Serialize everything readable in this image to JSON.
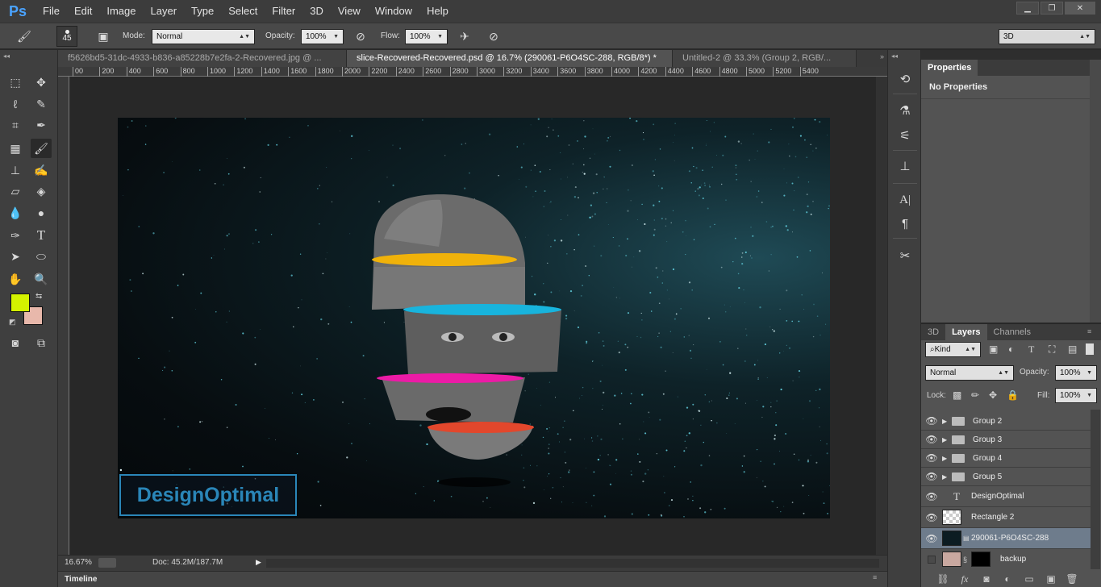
{
  "app": {
    "logo": "Ps"
  },
  "menu": [
    "File",
    "Edit",
    "Image",
    "Layer",
    "Type",
    "Select",
    "Filter",
    "3D",
    "View",
    "Window",
    "Help"
  ],
  "window_controls": {
    "minimize": "▁",
    "restore": "❐",
    "close": "✕"
  },
  "options": {
    "brush_size": "45",
    "mode_label": "Mode:",
    "mode_value": "Normal",
    "opacity_label": "Opacity:",
    "opacity_value": "100%",
    "flow_label": "Flow:",
    "flow_value": "100%",
    "workspace_value": "3D"
  },
  "tabs": [
    {
      "label": "f5626bd5-31dc-4933-b836-a85228b7e2fa-2-Recovered.jpg @ ..."
    },
    {
      "label": "slice-Recovered-Recovered.psd @ 16.7% (290061-P6O4SC-288, RGB/8*) *"
    },
    {
      "label": "Untitled-2 @ 33.3% (Group 2, RGB/..."
    }
  ],
  "ruler": [
    "00",
    "200",
    "400",
    "600",
    "800",
    "1000",
    "1200",
    "1400",
    "1600",
    "1800",
    "2000",
    "2200",
    "2400",
    "2600",
    "2800",
    "3000",
    "3200",
    "3400",
    "3600",
    "3800",
    "4000",
    "4200",
    "4400",
    "4600",
    "4800",
    "5000",
    "5200",
    "5400"
  ],
  "canvas": {
    "watermark": "DesignOptimal"
  },
  "colors": {
    "foreground": "#d4f200",
    "background": "#e8b8ab",
    "slice_yellow": "#f0b20a",
    "slice_cyan": "#18b4dd",
    "slice_magenta": "#ec1ba6",
    "slice_red": "#e2472c",
    "watermark_blue": "#2a86b8"
  },
  "status": {
    "zoom": "16.67%",
    "doc": "Doc: 45.2M/187.7M"
  },
  "timeline": {
    "label": "Timeline"
  },
  "properties": {
    "tab": "Properties",
    "content": "No Properties"
  },
  "layers_panel": {
    "tabs": [
      "3D",
      "Layers",
      "Channels"
    ],
    "kind_label": "Kind",
    "blend_mode": "Normal",
    "opacity_label": "Opacity:",
    "opacity_value": "100%",
    "lock_label": "Lock:",
    "fill_label": "Fill:",
    "fill_value": "100%",
    "layers": [
      {
        "name": "Group 2",
        "type": "group"
      },
      {
        "name": "Group 3",
        "type": "group"
      },
      {
        "name": "Group 4",
        "type": "group"
      },
      {
        "name": "Group 5",
        "type": "group"
      },
      {
        "name": "DesignOptimal",
        "type": "text"
      },
      {
        "name": "Rectangle 2",
        "type": "shape"
      },
      {
        "name": "290061-P6O4SC-288",
        "type": "image",
        "selected": true
      },
      {
        "name": "backup",
        "type": "image",
        "hidden": true
      }
    ]
  }
}
